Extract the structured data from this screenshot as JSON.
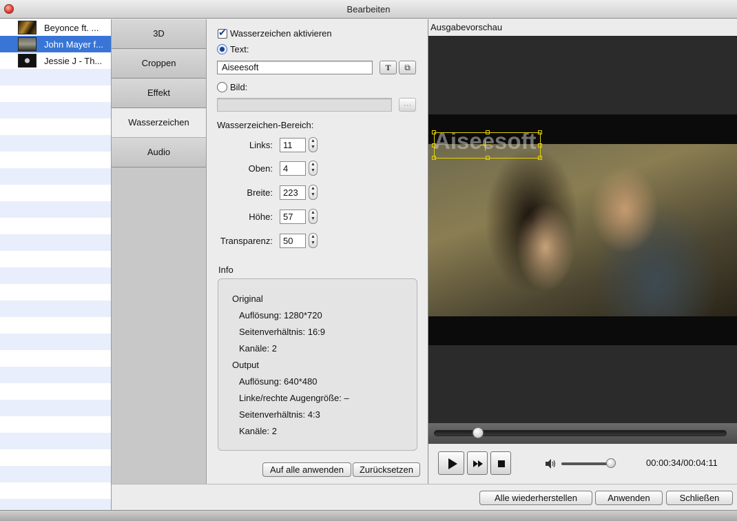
{
  "window": {
    "title": "Bearbeiten"
  },
  "files": [
    {
      "name": "Beyonce ft. ...",
      "thumb": "beyonce"
    },
    {
      "name": "John Mayer f...",
      "thumb": "john",
      "selected": true
    },
    {
      "name": "Jessie J - Th...",
      "thumb": "jessie"
    }
  ],
  "tabs": [
    "3D",
    "Croppen",
    "Effekt",
    "Wasserzeichen",
    "Audio"
  ],
  "active_tab": "Wasserzeichen",
  "watermark": {
    "enable_label": "Wasserzeichen aktivieren",
    "enabled": true,
    "text_label": "Text:",
    "text_value": "Aiseesoft",
    "text_button_icon": "T",
    "text_button2_icon": "⧉",
    "image_label": "Bild:",
    "browse_label": "···",
    "area_label": "Wasserzeichen-Bereich:",
    "fields": {
      "left": {
        "label": "Links:",
        "value": "11"
      },
      "top": {
        "label": "Oben:",
        "value": "4"
      },
      "width": {
        "label": "Breite:",
        "value": "223"
      },
      "height": {
        "label": "Höhe:",
        "value": "57"
      },
      "transparency": {
        "label": "Transparenz:",
        "value": "50"
      }
    }
  },
  "info": {
    "heading": "Info",
    "original_heading": "Original",
    "original_resolution": "Auflösung: 1280*720",
    "original_aspect": "Seitenverhältnis: 16:9",
    "original_channels": "Kanäle: 2",
    "output_heading": "Output",
    "output_resolution": "Auflösung: 640*480",
    "output_eye": "Linke/rechte Augengröße: –",
    "output_aspect": "Seitenverhältnis: 4:3",
    "output_channels": "Kanäle: 2"
  },
  "panel_buttons": {
    "apply_all": "Auf alle anwenden",
    "reset": "Zurücksetzen"
  },
  "preview": {
    "header": "Ausgabevorschau",
    "watermark_text": "Aiseesoft",
    "seek_progress": 0.15,
    "volume_level": 0.92,
    "time": "00:00:34/00:04:11"
  },
  "bottom_buttons": {
    "restore": "Alle wiederherstellen",
    "apply": "Anwenden",
    "close": "Schließen"
  },
  "colors": {
    "selection": "#3875d7",
    "watermark_box": "#e8d400"
  }
}
